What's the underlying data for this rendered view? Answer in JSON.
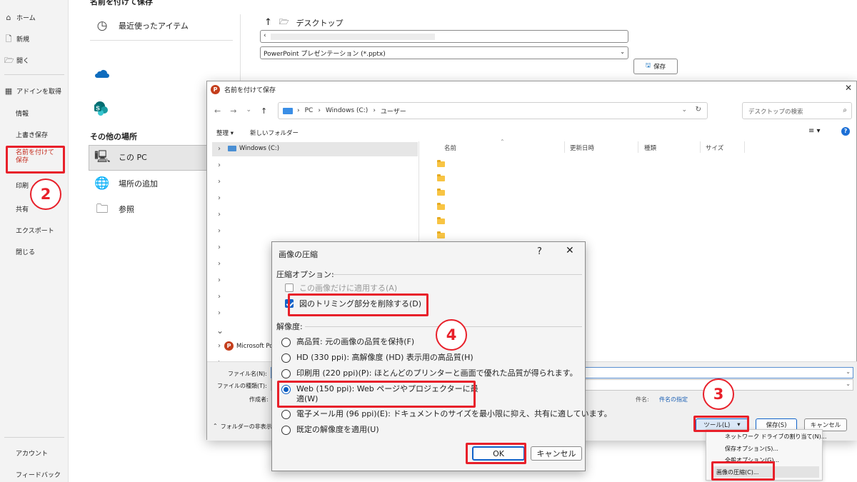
{
  "nav": {
    "top_cut": "名前を付けて保存",
    "home": "ホーム",
    "new": "新規",
    "open": "開く",
    "get_addins": "アドインを取得",
    "info": "情報",
    "save": "上書き保存",
    "save_as": "名前を付けて保存",
    "print": "印刷",
    "share": "共有",
    "export": "エクスポート",
    "close": "閉じる",
    "account": "アカウント",
    "feedback": "フィードバック"
  },
  "places": {
    "recent": "最近使ったアイテム",
    "other_header": "その他の場所",
    "this_pc": "この PC",
    "add_place": "場所の追加",
    "browse": "参照"
  },
  "backstage": {
    "path_folder": "デスクトップ",
    "filename_value": "‹",
    "filetype_value": "PowerPoint プレゼンテーション (*.pptx)",
    "save_button": "保存"
  },
  "save_dialog": {
    "title": "名前を付けて保存",
    "breadcrumb": [
      "PC",
      "Windows (C:)",
      "ユーザー"
    ],
    "search_placeholder": "デスクトップの検索",
    "organize": "整理 ▾",
    "new_folder": "新しいフォルダー",
    "tree_drive": "Windows (C:)",
    "tree_app": "Microsoft Pow",
    "columns": [
      "名前",
      "更新日時",
      "種類",
      "サイズ"
    ],
    "filename_label": "ファイル名(N):",
    "filetype_label": "ファイルの種類(T):",
    "author_label": "作成者:",
    "tags_label": "件名:",
    "tags_link": "件名の指定",
    "hide_folders": "フォルダーの非表示",
    "tools_button": "ツール(L)",
    "save_button": "保存(S)",
    "cancel_button": "キャンセル"
  },
  "tools_menu": {
    "items": [
      "ネットワーク ドライブの割り当て(N)...",
      "保存オプション(S)...",
      "全般オプション(G)...",
      "画像の圧縮(C)..."
    ]
  },
  "compress_dialog": {
    "title": "画像の圧縮",
    "help": "?",
    "close": "✕",
    "options_header": "圧縮オプション:",
    "apply_only_this": "この画像だけに適用する(A)",
    "delete_cropped": "図のトリミング部分を削除する(D)",
    "resolution_header": "解像度:",
    "options": [
      "高品質: 元の画像の品質を保持(F)",
      "HD (330 ppi): 高解像度 (HD) 表示用の高品質(H)",
      "印刷用 (220 ppi)(P): ほとんどのプリンターと画面で優れた品質が得られます。",
      "Web (150 ppi): Web ページやプロジェクターに最",
      "電子メール用 (96 ppi)(E): ドキュメントのサイズを最小限に抑え、共有に適しています。",
      "既定の解像度を適用(U)"
    ],
    "web_line2": "適(W)",
    "ok": "OK",
    "cancel": "キャンセル"
  },
  "callouts": [
    "2",
    "3",
    "4"
  ],
  "colors": {
    "highlight": "#e8202a",
    "accent": "#0a5dc2",
    "nav_active": "#c42b1c"
  }
}
